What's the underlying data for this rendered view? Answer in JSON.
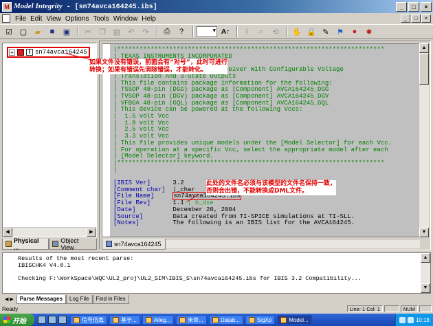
{
  "window": {
    "app_name": "Model Integrity",
    "doc_title": " - [sn74avca164245.ibs]",
    "controls": [
      "_",
      "□",
      "×"
    ]
  },
  "menu": [
    "File",
    "Edit",
    "View",
    "Options",
    "Tools",
    "Window",
    "Help"
  ],
  "mdi_controls": [
    "_",
    "□",
    "×"
  ],
  "toolbar": {
    "font_button": "A↑"
  },
  "tree": {
    "root_label": "sn74avca164245",
    "expander": "+"
  },
  "left_tabs": [
    "Physical ...",
    "Object View"
  ],
  "editor_tab": "sn74avca164245",
  "code_lines": [
    {
      "cls": "g",
      "text": "|************************************************************************"
    },
    {
      "cls": "g",
      "text": "| TEXAS INSTRUMENTS INCORPORATED"
    },
    {
      "cls": "g",
      "text": "|"
    },
    {
      "cls": "g",
      "text": "| 16-Bit Dual Supply Bus Transceiver With Configurable Voltage"
    },
    {
      "cls": "g",
      "text": "| Translation And 3-State Outputs"
    },
    {
      "cls": "g",
      "text": "| This file contains package information for the following:"
    },
    {
      "cls": "g",
      "text": "| TSSOP 48-pin (DGG) package as [Component] AVCA164245_DGG"
    },
    {
      "cls": "g",
      "text": "| TVSOP 48-pin (DGV) package as [Component] AVCA164245_DGV"
    },
    {
      "cls": "g",
      "text": "| VFBGA 48-pin (GQL) package as [Component] AVCA164245_GQL"
    },
    {
      "cls": "g",
      "text": "| This device can be powered at the following Vccs:"
    },
    {
      "cls": "g",
      "text": "|  1.5 volt Vcc"
    },
    {
      "cls": "g",
      "text": "|  1.8 volt Vcc"
    },
    {
      "cls": "g",
      "text": "|  2.5 volt Vcc"
    },
    {
      "cls": "g",
      "text": "|  3.3 volt Vcc"
    },
    {
      "cls": "g",
      "text": "| This file provides unique models under the [Model Selector] for each Vcc."
    },
    {
      "cls": "g",
      "text": "| For operation at a specific Vcc, select the appropriate model after each"
    },
    {
      "cls": "g",
      "text": "| [Model Selector] keyword."
    },
    {
      "cls": "g",
      "text": "|************************************************************************"
    },
    {
      "cls": "g",
      "text": "|"
    },
    {
      "cls": "k",
      "text": ""
    },
    {
      "cls": "kv",
      "key": "[IBIS Ver]",
      "val": "3.2",
      "extra": ""
    },
    {
      "cls": "kv",
      "key": "[Comment char]",
      "val": "|_char",
      "extra": ""
    },
    {
      "cls": "kv",
      "key": "[File Name]",
      "val": "sn74avca164245.ibs",
      "extra": "",
      "boxed": true
    },
    {
      "cls": "kv",
      "key": "[File Rev]",
      "val": "1.1",
      "extra": " | b_die"
    },
    {
      "cls": "kv",
      "key": "[Date]",
      "val": "December 20, 2004",
      "extra": ""
    },
    {
      "cls": "kv",
      "key": "[Source]",
      "val": "Data created from TI-SPICE simulations at TI-SLL.",
      "extra": ""
    },
    {
      "cls": "kv",
      "key": "[Notes]",
      "val": "The following is an IBIS list for the AVCA164245.",
      "extra": ""
    }
  ],
  "annotations": {
    "top_line1": "如果文件没有错误，前面会有“对号”，此时可进行",
    "top_line2": "转换；如果有错误先消除错误，才能转化。",
    "mid_line1": "此处的文件名必须与该模型的文件名保持一致，",
    "mid_line2": "否则会出错，不能转换成DML文件。"
  },
  "output_lines": [
    "Results of the most recent parse:",
    "IBISCHK4 V4.0.1",
    "",
    "Checking F:\\WorkSpace\\WQC\\UL2_proj\\UL2_SIM\\IBIS_S\\sn74avca164245.ibs for IBIS 3.2 Compatibility..."
  ],
  "output_tabs": [
    "Parse Messages",
    "Log File",
    "Find in Files"
  ],
  "status": {
    "ready": "Ready",
    "position": "Line: 1  Col: 1",
    "num": "NUM"
  },
  "taskbar": {
    "start": "开始",
    "tasks": [
      "信号仿真",
      "基于...",
      "Alleg...",
      "未命...",
      "Datab...",
      "SigXp",
      "Model..."
    ],
    "clock": "10:18"
  }
}
